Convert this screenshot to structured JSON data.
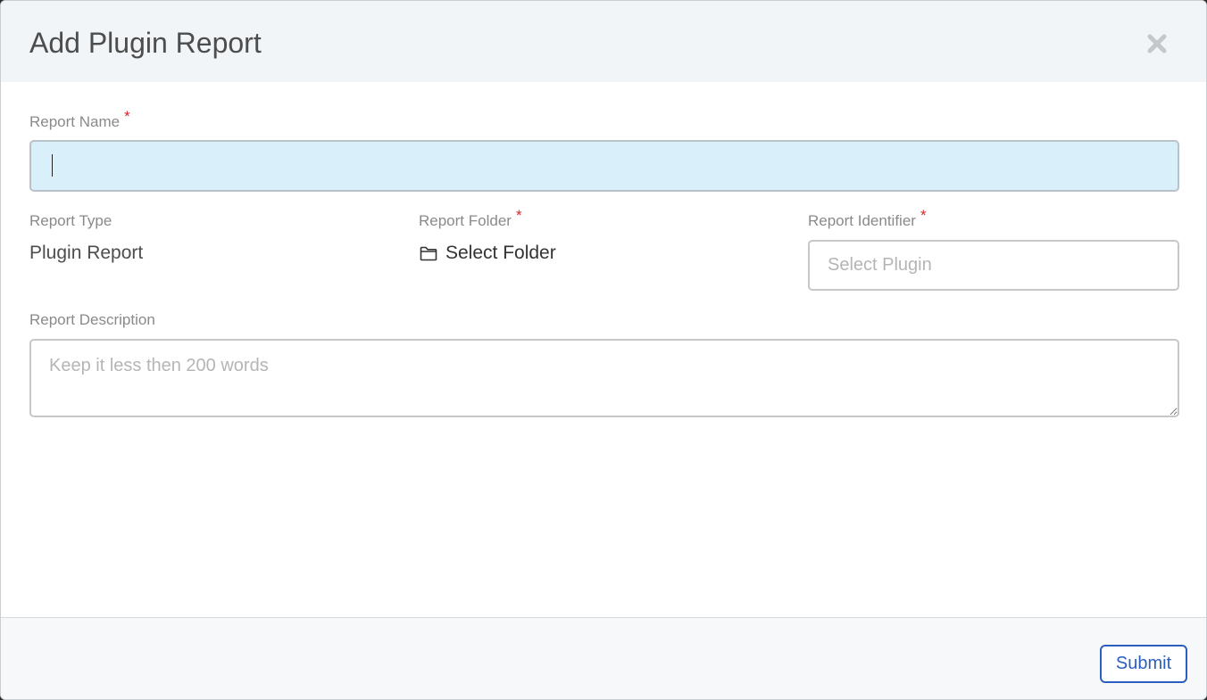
{
  "modal": {
    "title": "Add Plugin Report"
  },
  "form": {
    "report_name": {
      "label": "Report Name",
      "required_mark": "*",
      "value": ""
    },
    "report_type": {
      "label": "Report Type",
      "value": "Plugin Report"
    },
    "report_folder": {
      "label": "Report Folder",
      "required_mark": "*",
      "value": "Select Folder",
      "icon": "folder-icon"
    },
    "report_identifier": {
      "label": "Report Identifier",
      "required_mark": "*",
      "placeholder": "Select Plugin"
    },
    "report_description": {
      "label": "Report Description",
      "placeholder": "Keep it less then 200 words"
    }
  },
  "footer": {
    "submit_label": "Submit"
  },
  "colors": {
    "header_bg": "#f1f5f8",
    "focused_input_bg": "#d9f0fb",
    "required_mark": "#d9262c",
    "primary": "#2b5fbf"
  },
  "icons": {
    "close": "close-icon",
    "folder": "folder-icon"
  }
}
